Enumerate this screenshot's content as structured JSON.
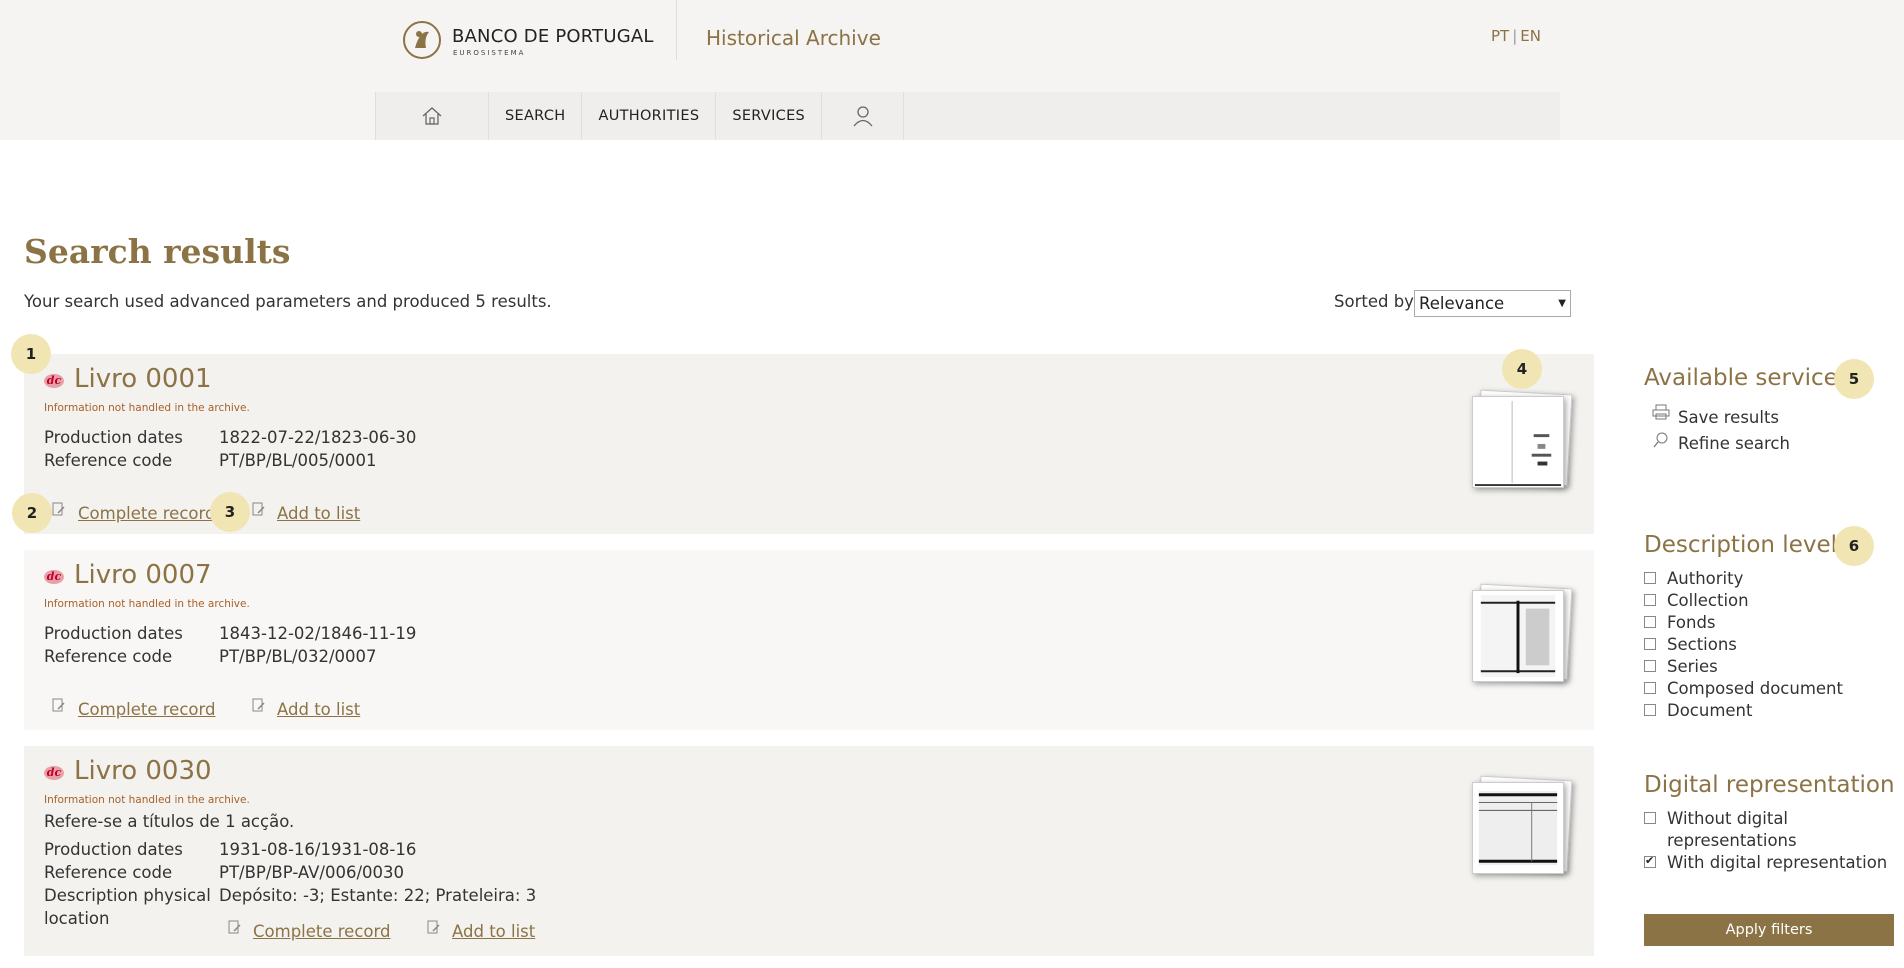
{
  "header": {
    "logo_main": "BANCO DE PORTUGAL",
    "logo_sub": "EUROSISTEMA",
    "site_title": "Historical Archive",
    "lang_pt": "PT",
    "lang_sep": "|",
    "lang_en": "EN"
  },
  "nav": {
    "home_icon": "home-icon",
    "search": "SEARCH",
    "authorities": "AUTHORITIES",
    "services": "SERVICES",
    "user_icon": "user-icon"
  },
  "main": {
    "title": "Search results",
    "summary": "Your search used advanced parameters and produced 5 results.",
    "sorted_by_label": "Sorted by",
    "sort_value": "Relevance"
  },
  "results": [
    {
      "title": "Livro 0001",
      "note": "Information not handled in the archive.",
      "fields": [
        {
          "label": "Production dates",
          "value": "1822-07-22/1823-06-30"
        },
        {
          "label": "Reference code",
          "value": "PT/BP/BL/005/0001"
        }
      ],
      "complete_record": "Complete record",
      "add_to_list": "Add to list"
    },
    {
      "title": "Livro 0007",
      "note": "Information not handled in the archive.",
      "fields": [
        {
          "label": "Production dates",
          "value": "1843-12-02/1846-11-19"
        },
        {
          "label": "Reference code",
          "value": "PT/BP/BL/032/0007"
        }
      ],
      "complete_record": "Complete record",
      "add_to_list": "Add to list"
    },
    {
      "title": "Livro 0030",
      "note": "Information not handled in the archive.",
      "description": "Refere-se a títulos de 1 acção.",
      "fields": [
        {
          "label": "Production dates",
          "value": "1931-08-16/1931-08-16"
        },
        {
          "label": "Reference code",
          "value": "PT/BP/BP-AV/006/0030"
        },
        {
          "label": "Description physical",
          "value": "Depósito: -3; Estante: 22; Prateleira: 3"
        },
        {
          "label": "location",
          "value": ""
        }
      ],
      "complete_record": "Complete record",
      "add_to_list": "Add to list"
    }
  ],
  "sidebar": {
    "services_heading": "Available services",
    "save_results": "Save results",
    "refine_search": "Refine search",
    "levels_heading": "Description levels",
    "levels": [
      {
        "label": "Authority",
        "checked": false
      },
      {
        "label": "Collection",
        "checked": false
      },
      {
        "label": "Fonds",
        "checked": false
      },
      {
        "label": "Sections",
        "checked": false
      },
      {
        "label": "Series",
        "checked": false
      },
      {
        "label": "Composed document",
        "checked": false
      },
      {
        "label": "Document",
        "checked": false
      }
    ],
    "digital_heading": "Digital representation",
    "digital": [
      {
        "label": "Without digital representations",
        "checked": false
      },
      {
        "label": "With digital representation",
        "checked": true
      }
    ],
    "apply_button": "Apply filters"
  },
  "badges": [
    "1",
    "2",
    "3",
    "4",
    "5",
    "6"
  ],
  "colors": {
    "accent": "#8c7345",
    "badge": "#f1e5b3",
    "note": "#a8612a",
    "result_bg": "#f3f2ef"
  }
}
